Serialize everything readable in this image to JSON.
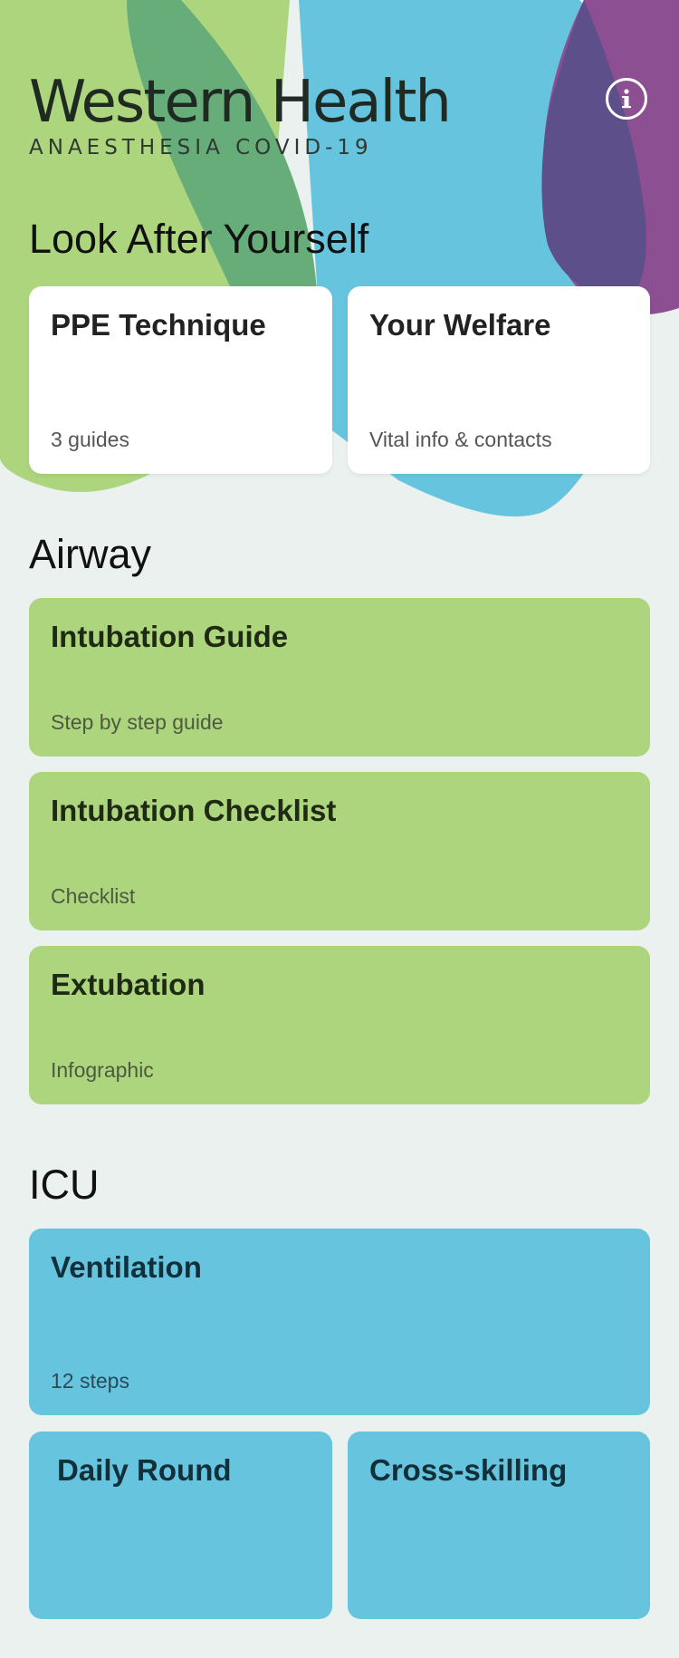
{
  "header": {
    "brand": "Western Health",
    "subtitle": "ANAESTHESIA COVID-19",
    "info_icon": "info-icon"
  },
  "sections": {
    "look_after": {
      "title": "Look After Yourself",
      "cards": [
        {
          "title": "PPE Technique",
          "sub": "3 guides"
        },
        {
          "title": "Your Welfare",
          "sub": "Vital info & contacts"
        }
      ]
    },
    "airway": {
      "title": "Airway",
      "cards": [
        {
          "title": "Intubation Guide",
          "sub": "Step by step guide"
        },
        {
          "title": "Intubation Checklist",
          "sub": "Checklist"
        },
        {
          "title": "Extubation",
          "sub": "Infographic"
        }
      ]
    },
    "icu": {
      "title": "ICU",
      "cards": [
        {
          "title": "Ventilation",
          "sub": "12 steps"
        },
        {
          "title": "Daily Round",
          "sub": ""
        },
        {
          "title": "Cross-skilling",
          "sub": ""
        }
      ]
    }
  },
  "colors": {
    "background": "#eaf1ef",
    "green": "#add57d",
    "blue": "#67c4df",
    "purple": "#8b4f92",
    "white_card": "#ffffff"
  }
}
